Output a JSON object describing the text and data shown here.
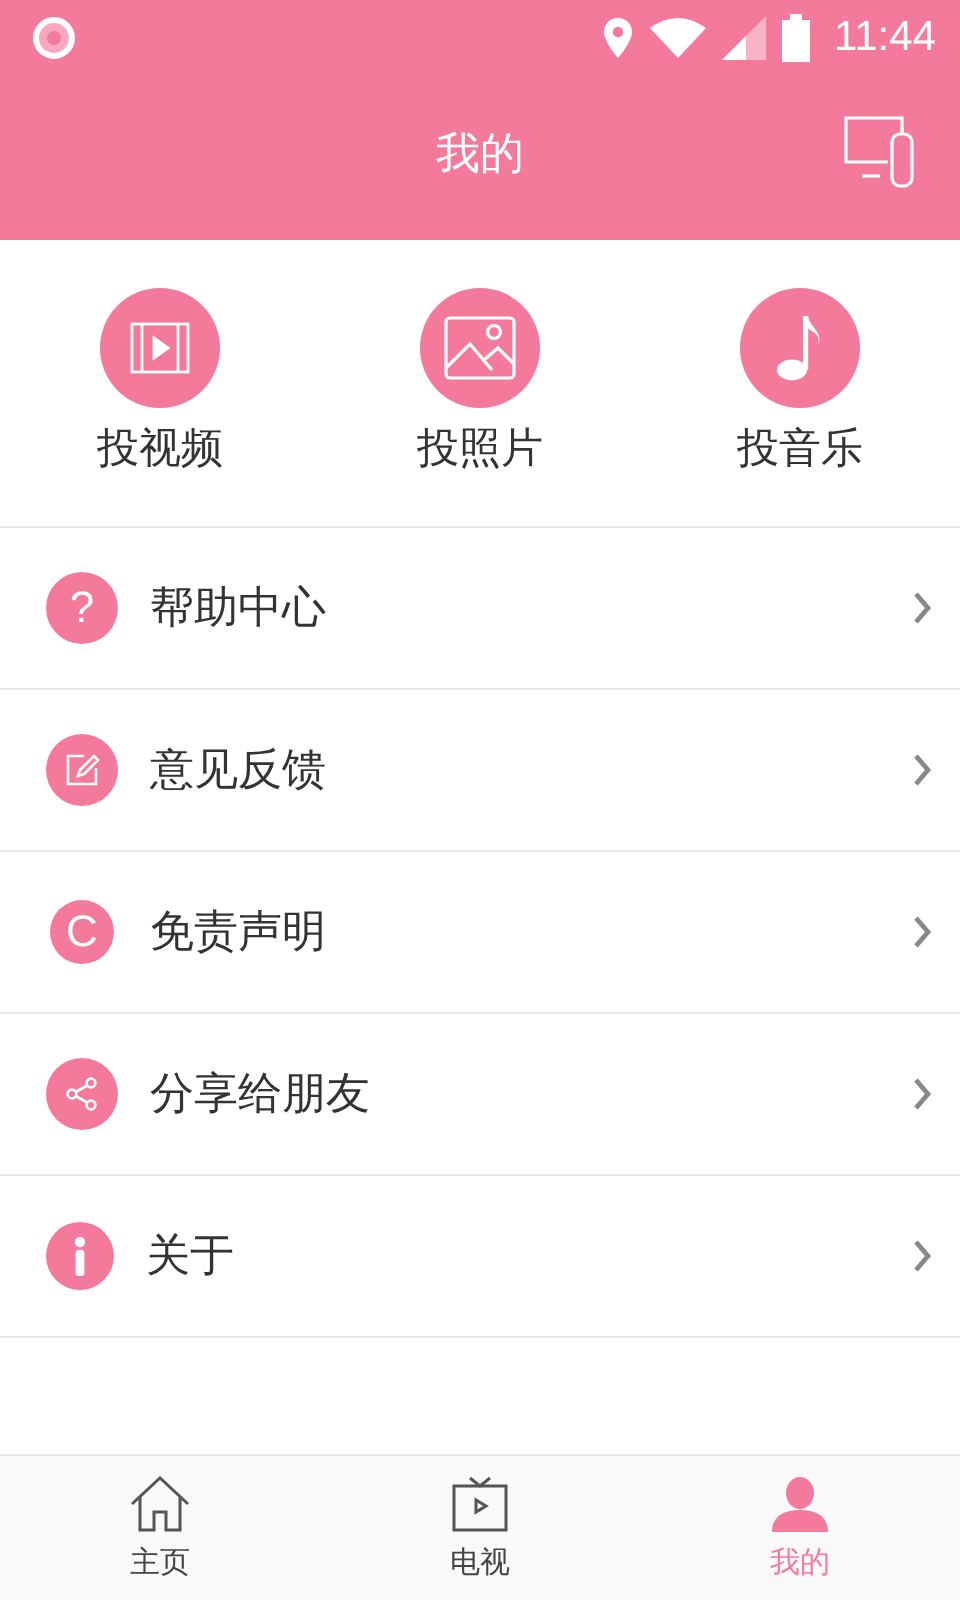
{
  "status_bar": {
    "time": "11:44"
  },
  "header": {
    "title": "我的"
  },
  "quick_actions": [
    {
      "kind": "video",
      "label": "投视频"
    },
    {
      "kind": "photo",
      "label": "投照片"
    },
    {
      "kind": "music",
      "label": "投音乐"
    }
  ],
  "menu": [
    {
      "kind": "help",
      "glyph": "?",
      "label": "帮助中心"
    },
    {
      "kind": "feedback",
      "label": "意见反馈"
    },
    {
      "kind": "disclaimer",
      "glyph": "C",
      "label": "免责声明"
    },
    {
      "kind": "share",
      "label": "分享给朋友"
    },
    {
      "kind": "about",
      "label": "关于"
    }
  ],
  "tabs": [
    {
      "kind": "home",
      "label": "主页",
      "selected": false
    },
    {
      "kind": "tv",
      "label": "电视",
      "selected": false
    },
    {
      "kind": "me",
      "label": "我的",
      "selected": true
    }
  ]
}
